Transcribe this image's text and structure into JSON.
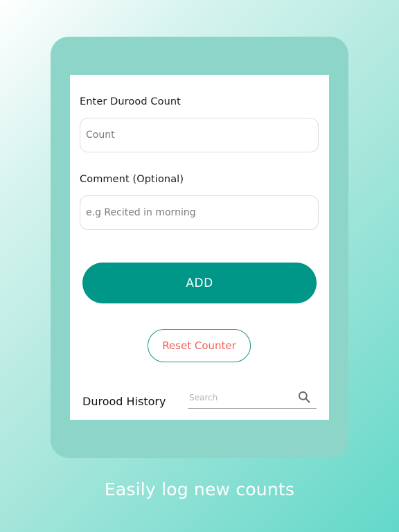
{
  "form": {
    "count_label": "Enter Durood Count",
    "count_placeholder": "Count",
    "comment_label": "Comment (Optional)",
    "comment_placeholder": "e.g Recited in morning",
    "add_label": "ADD",
    "reset_label": "Reset Counter"
  },
  "history": {
    "title": "Durood History",
    "search_placeholder": "Search",
    "search_icon": "search-icon"
  },
  "caption": "Easily log new counts",
  "colors": {
    "primary": "#009688",
    "reset_text": "#f25f5c",
    "device_frame": "#8dd5c9"
  }
}
